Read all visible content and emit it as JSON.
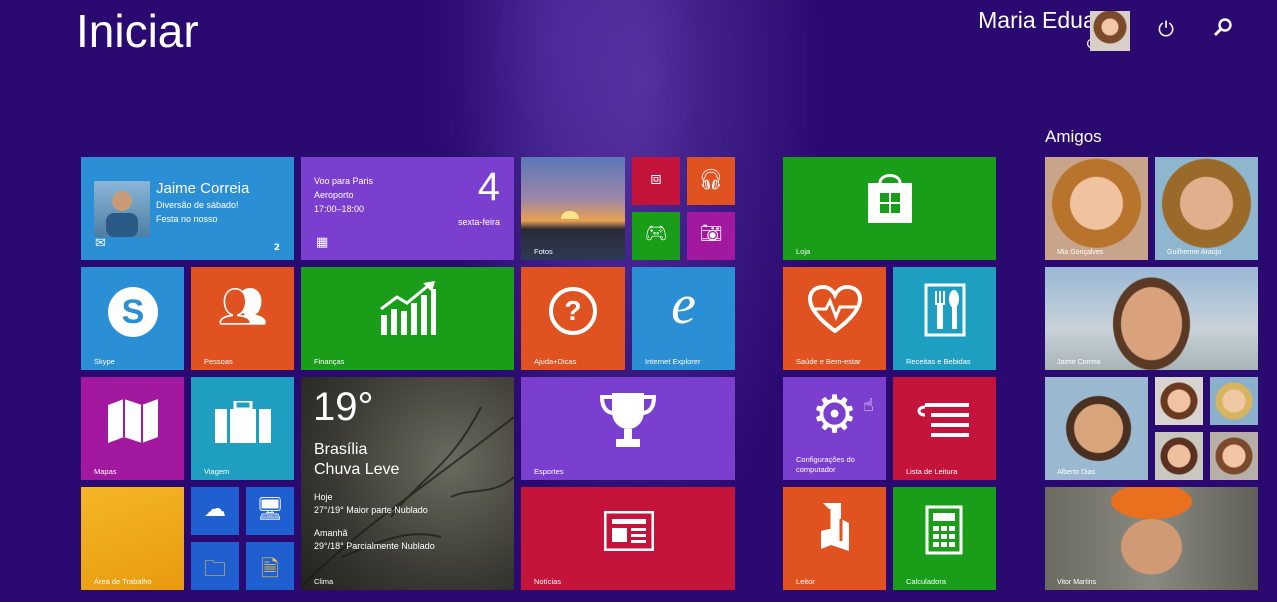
{
  "header": {
    "title": "Iniciar",
    "user_name": "Maria Eduarda",
    "user_surname": "Correia",
    "power_icon": "power-icon",
    "search_icon": "search-icon"
  },
  "tiles": {
    "mail": {
      "name": "Jaime Correia",
      "line1": "Diversão de sábado!",
      "line2": "Festa no nosso",
      "count": "2"
    },
    "calendar": {
      "line1": "Voo para Paris",
      "line2": "Aeroporto",
      "line3": "17:00–18:00",
      "day": "4",
      "weekday": "sexta-feira"
    },
    "photos": "Fotos",
    "store": "Loja",
    "skype": "Skype",
    "people": "Pessoas",
    "finance": "Finanças",
    "help": "Ajuda+Dicas",
    "ie": "Internet Explorer",
    "health": "Saúde e Bem-estar",
    "recipes": "Receitas e Bebidas",
    "maps": "Mapas",
    "travel": "Viagem",
    "weather": {
      "temp": "19°",
      "city": "Brasília",
      "cond": "Chuva Leve",
      "today_label": "Hoje",
      "today": "27°/19° Maior parte Nublado",
      "tomorrow_label": "Amanhã",
      "tomorrow": "29°/18° Parcialmente Nublado",
      "label": "Clima"
    },
    "sports": "Esportes",
    "settings": "Configurações do computador",
    "reading": "Lista de Leitura",
    "desktop": "Área de Trabalho",
    "news": "Notícias",
    "reader": "Leitor",
    "calc": "Calculadora"
  },
  "friends": {
    "title": "Amigos",
    "people": [
      "Mia Gonçalves",
      "Guilherme Araújo",
      "Jaime Correia",
      "Alberto Dias",
      "Vitor Martins"
    ]
  },
  "colors": {
    "bg": "#2a0a70",
    "blue": "#2b8fd6",
    "purple": "#7b3fd0",
    "green": "#1a9e1a",
    "orange": "#e0521f",
    "teal": "#1e9fc2",
    "magenta": "#a2189e",
    "red": "#c4143c",
    "darkblue": "#1f5fcf"
  }
}
